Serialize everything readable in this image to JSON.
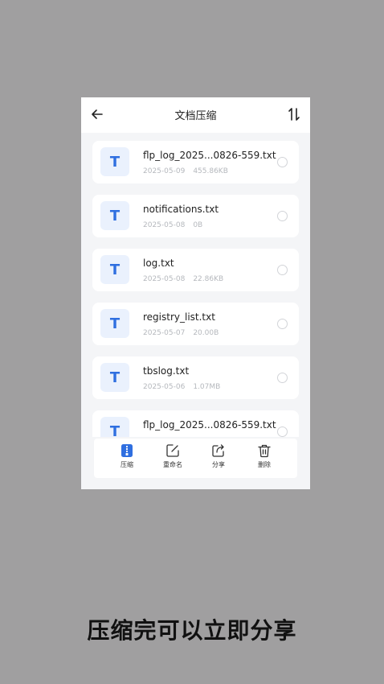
{
  "header": {
    "title": "文档压缩",
    "back_icon": "arrow-left-icon",
    "sort_icon": "sort-icon"
  },
  "files": [
    {
      "icon_letter": "T",
      "name": "flp_log_2025...0826-559.txt",
      "date": "2025-05-09",
      "size": "455.86KB"
    },
    {
      "icon_letter": "T",
      "name": "notifications.txt",
      "date": "2025-05-08",
      "size": "0B"
    },
    {
      "icon_letter": "T",
      "name": "log.txt",
      "date": "2025-05-08",
      "size": "22.86KB"
    },
    {
      "icon_letter": "T",
      "name": "registry_list.txt",
      "date": "2025-05-07",
      "size": "20.00B"
    },
    {
      "icon_letter": "T",
      "name": "tbslog.txt",
      "date": "2025-05-06",
      "size": "1.07MB"
    },
    {
      "icon_letter": "T",
      "name": "flp_log_2025...0826-559.txt",
      "date": "",
      "size": ""
    }
  ],
  "toolbar": {
    "compress_label": "压缩",
    "rename_label": "重命名",
    "share_label": "分享",
    "delete_label": "删除"
  },
  "caption": "压缩完可以立即分享",
  "colors": {
    "background": "#a09fa0",
    "accent": "#2f6fe0",
    "file_icon_bg": "#eaf1fd"
  }
}
